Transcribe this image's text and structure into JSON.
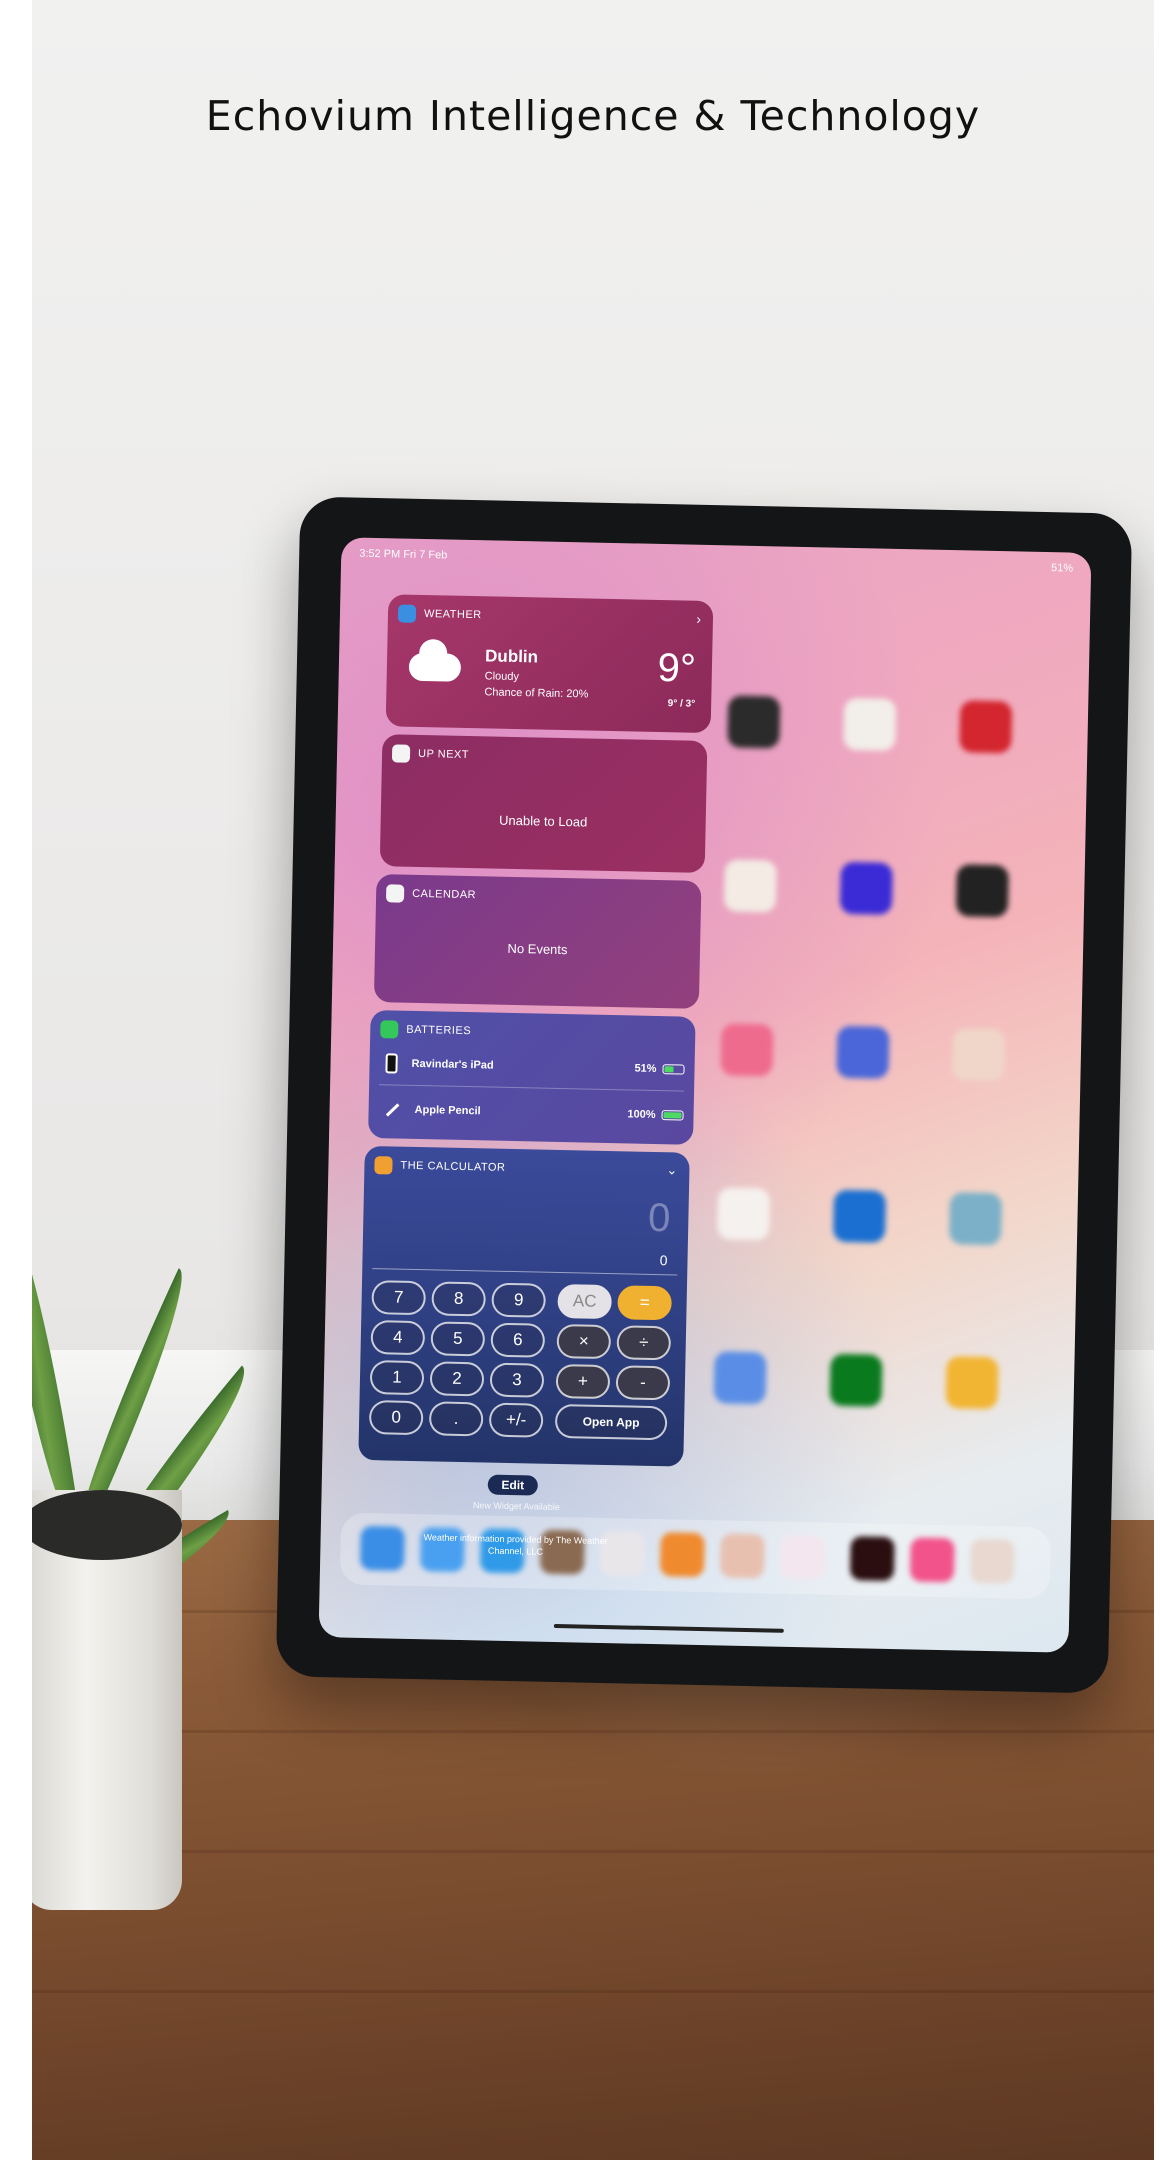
{
  "headline": "Echovium Intelligence & Technology",
  "status_bar": {
    "time_date": "3:52 PM  Fri 7 Feb",
    "battery": "51%"
  },
  "weather": {
    "label": "WEATHER",
    "city": "Dublin",
    "condition": "Cloudy",
    "rain": "Chance of Rain: 20%",
    "temp": "9°",
    "range": "9° / 3°"
  },
  "up_next": {
    "label": "UP NEXT",
    "message": "Unable to Load"
  },
  "calendar": {
    "label": "CALENDAR",
    "message": "No Events"
  },
  "batteries": {
    "label": "BATTERIES",
    "items": [
      {
        "name": "Ravindar's iPad",
        "percent": "51%",
        "level": 0.51
      },
      {
        "name": "Apple Pencil",
        "percent": "100%",
        "level": 1.0
      }
    ]
  },
  "calculator": {
    "label": "THE CALCULATOR",
    "display": "0",
    "sub_display": "0",
    "keys": {
      "k7": "7",
      "k8": "8",
      "k9": "9",
      "ac": "AC",
      "eq": "=",
      "k4": "4",
      "k5": "5",
      "k6": "6",
      "mul": "×",
      "div": "÷",
      "k1": "1",
      "k2": "2",
      "k3": "3",
      "add": "+",
      "sub": "-",
      "k0": "0",
      "dot": ".",
      "sign": "+/-",
      "open": "Open App"
    }
  },
  "edit_label": "Edit",
  "new_widget": "New Widget Available",
  "weather_credit": "Weather information provided by The Weather Channel, LLC",
  "colors": {
    "accent_orange": "#f0b030",
    "battery_green": "#4cd964"
  }
}
